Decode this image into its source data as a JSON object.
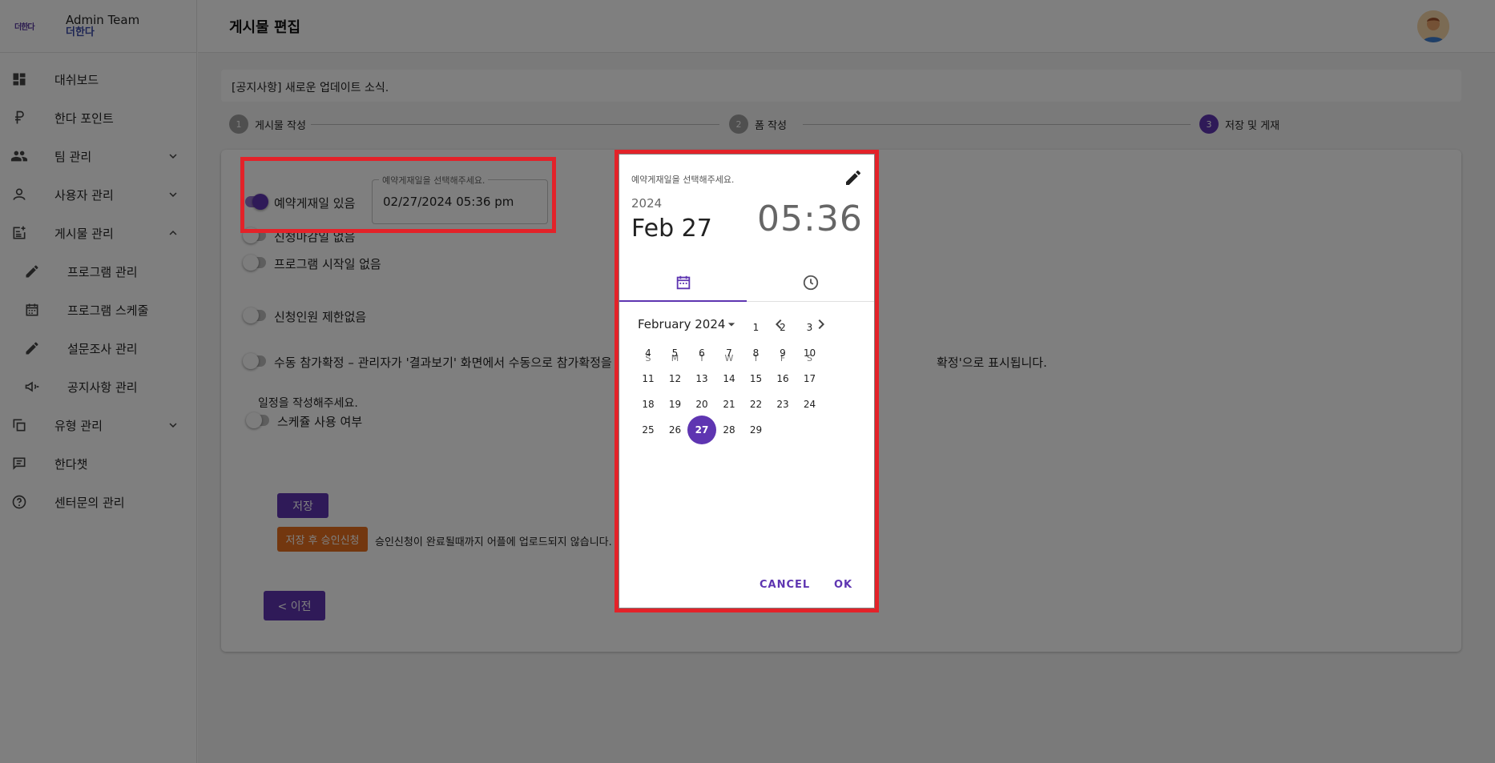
{
  "brand": {
    "logo_text": "더한다",
    "title": "Admin Team",
    "subtitle": "더한다"
  },
  "sidebar": {
    "items": [
      {
        "label": "대쉬보드",
        "icon": "dashboard-icon"
      },
      {
        "label": "한다 포인트",
        "icon": "point-currency-icon"
      },
      {
        "label": "팀 관리",
        "icon": "team-icon",
        "expand": "chevron-down"
      },
      {
        "label": "사용자 관리",
        "icon": "user-icon",
        "expand": "chevron-down"
      },
      {
        "label": "게시물 관리",
        "icon": "post-add-icon",
        "expand": "chevron-up"
      },
      {
        "label": "프로그램 관리",
        "icon": "pencil-icon",
        "sub": true
      },
      {
        "label": "프로그램 스케줄",
        "icon": "calendar-icon",
        "sub": true
      },
      {
        "label": "설문조사 관리",
        "icon": "pencil-icon",
        "sub": true
      },
      {
        "label": "공지사항 관리",
        "icon": "megaphone-icon",
        "sub": true
      },
      {
        "label": "유형 관리",
        "icon": "copy-icon",
        "expand": "chevron-down"
      },
      {
        "label": "한다챗",
        "icon": "chat-icon"
      },
      {
        "label": "센터문의 관리",
        "icon": "help-icon"
      }
    ]
  },
  "header": {
    "title": "게시물 편집"
  },
  "notice": {
    "text": "[공지사항] 새로운 업데이트 소식."
  },
  "stepper": {
    "steps": [
      {
        "number": "1",
        "label": "게시물 작성",
        "active": false
      },
      {
        "number": "2",
        "label": "폼 작성",
        "active": false
      },
      {
        "number": "3",
        "label": "저장 및 게재",
        "active": true
      }
    ]
  },
  "form": {
    "reserve_toggle_label": "예약게재일 있음",
    "reserve_toggle_on": true,
    "reserve_field_legend": "예약게재일을 선택해주세요.",
    "reserve_field_value": "02/27/2024 05:36 pm",
    "deadline_label": "신청마감일 없음",
    "program_start_label": "프로그램 시작일 없음",
    "capacity_label": "신청인원 제한없음",
    "manual_confirm_label": "수동 참가확정 – 관리자가 '결과보기' 화면에서 수동으로 참가확정을",
    "manual_confirm_tail": "확정'으로 표시됩니다.",
    "schedule_prompt": "일정을 작성해주세요.",
    "schedule_toggle_label": "스케쥴 사용 여부",
    "save_button": "저장",
    "approve_button": "저장 후 승인신청",
    "approve_note": "승인신청이 완료될때까지 어플에 업로드되지 않습니다.",
    "prev_button": "< 이전"
  },
  "picker": {
    "caption": "예약게재일을 선택해주세요.",
    "year": "2024",
    "date": "Feb 27",
    "hour": "05",
    "minute": "36",
    "month_label": "February 2024",
    "weekdays": [
      "S",
      "M",
      "T",
      "W",
      "T",
      "F",
      "S"
    ],
    "first_weekday": 4,
    "days_in_month": 29,
    "selected_day": 27,
    "cancel": "CANCEL",
    "ok": "OK"
  },
  "colors": {
    "accent": "#5e35b1",
    "approve": "#e66f1f",
    "highlight": "#e32229"
  }
}
